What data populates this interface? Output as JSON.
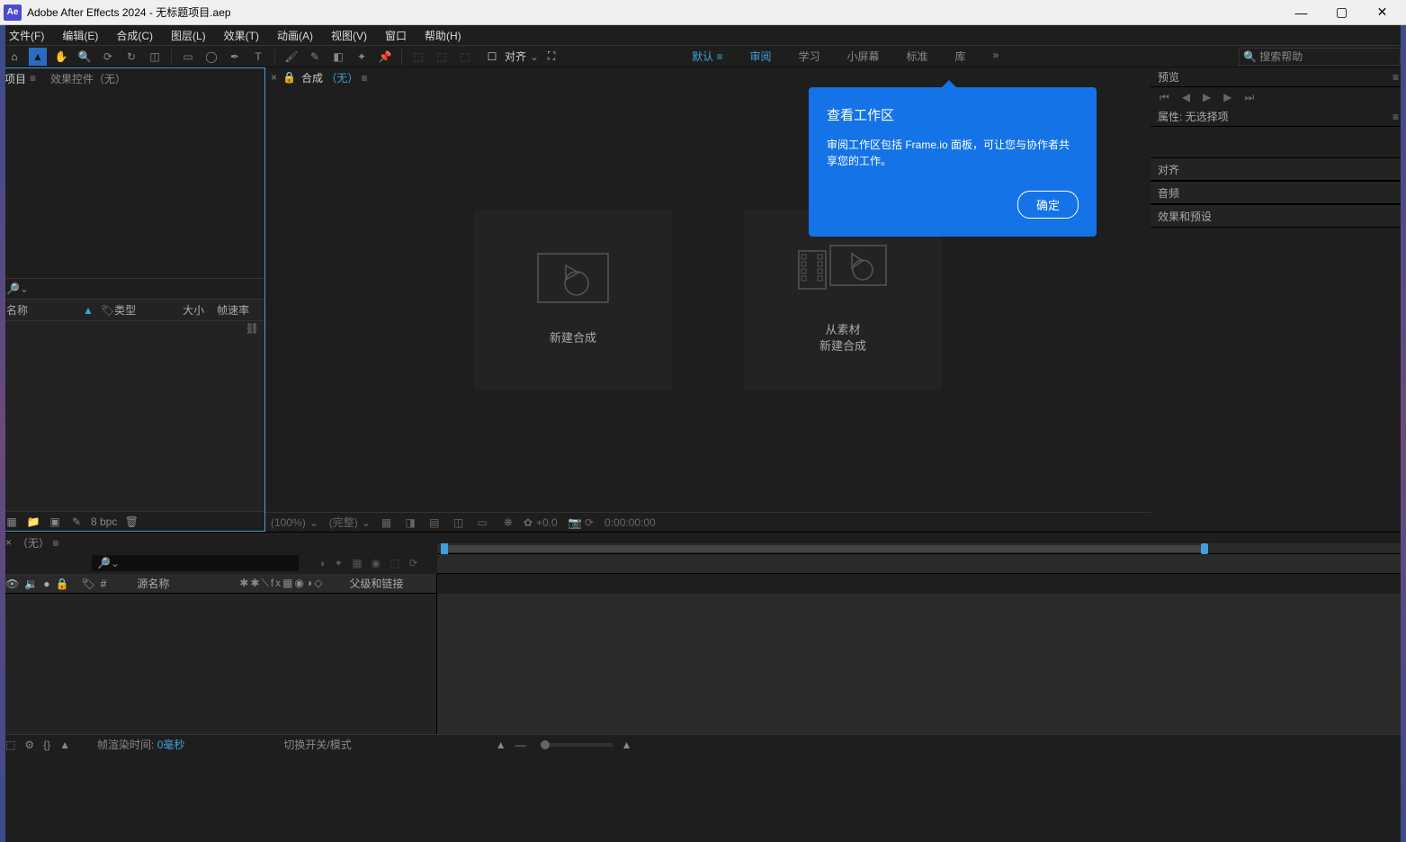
{
  "titlebar": {
    "app": "Adobe After Effects 2024",
    "file": "无标题项目.aep",
    "icon": "Ae"
  },
  "menubar": [
    "文件(F)",
    "编辑(E)",
    "合成(C)",
    "图层(L)",
    "效果(T)",
    "动画(A)",
    "视图(V)",
    "窗口",
    "帮助(H)"
  ],
  "toolbar": {
    "align_label": "对齐",
    "workspaces": {
      "default": "默认",
      "review": "审阅",
      "learn": "学习",
      "small": "小屏幕",
      "standard": "标准",
      "lib": "库"
    },
    "search_placeholder": "搜索帮助"
  },
  "project": {
    "tab_project": "项目",
    "tab_effect": "效果控件（无）",
    "cols": {
      "name": "名称",
      "type": "类型",
      "size": "大小",
      "fps": "帧速率"
    },
    "footer_bpc": "8 bpc"
  },
  "comp": {
    "label": "合成",
    "none": "（无）",
    "new_comp": "新建合成",
    "from_footage": "从素材",
    "from_footage2": "新建合成",
    "zoom": "(100%)",
    "res": "(完整)",
    "exposure": "+0.0",
    "timecode": "0:00:00:00"
  },
  "popup": {
    "title": "查看工作区",
    "body": "审阅工作区包括 Frame.io 面板，可让您与协作者共享您的工作。",
    "ok": "确定"
  },
  "right": {
    "preview": "预览",
    "props": "属性: 无选择项",
    "align": "对齐",
    "audio": "音频",
    "effects": "效果和预设"
  },
  "timeline": {
    "tab": "（无）",
    "src_name": "源名称",
    "parent": "父级和链接",
    "render_time": "帧渲染时间:",
    "render_val": "0毫秒",
    "switch": "切换开关/模式"
  }
}
